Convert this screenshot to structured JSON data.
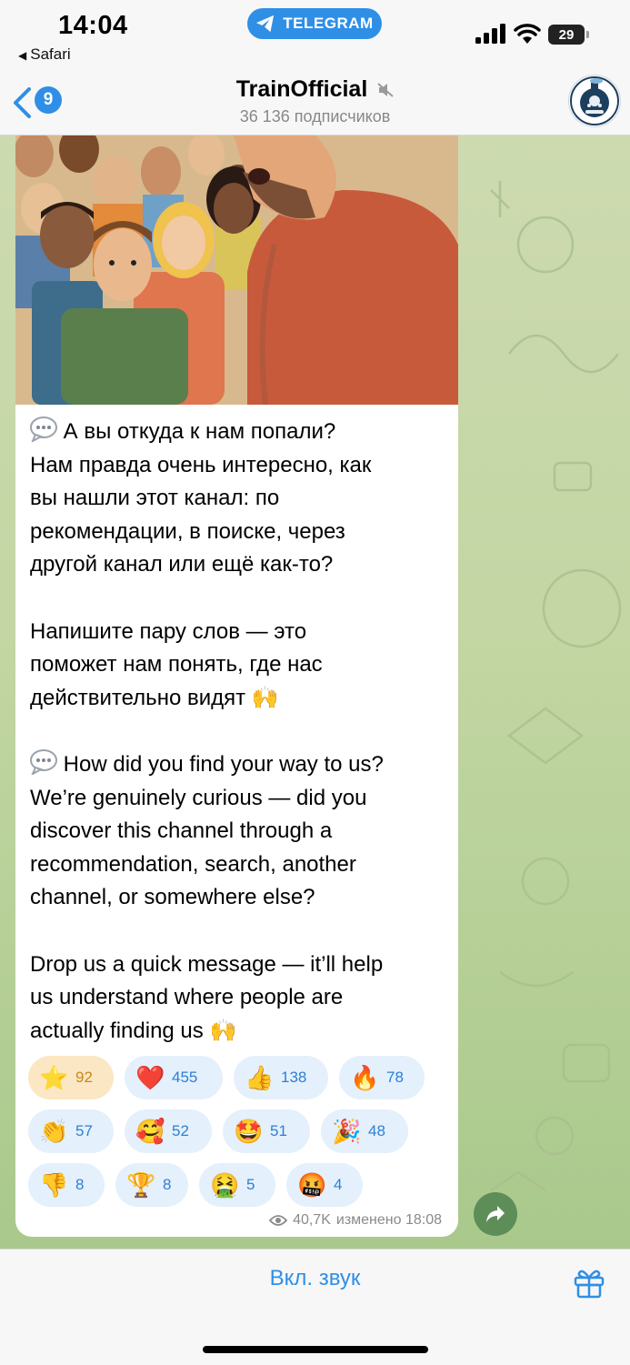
{
  "status_bar": {
    "time": "14:04",
    "back_app": "Safari",
    "app_pill": "TELEGRAM",
    "battery": "29"
  },
  "header": {
    "unread_count": "9",
    "channel_title": "TrainOfficial",
    "subscribers": "36 136 подписчиков",
    "icons": [
      "chevron-left-icon",
      "mute-icon",
      "channel-avatar"
    ]
  },
  "message": {
    "paragraphs": [
      "А вы откуда к нам попали?\nНам правда очень интересно, как\nвы нашли этот канал: по\nрекомендации, в поиске, через\nдругой канал или ещё как-то?",
      "Напишите пару слов — это\nпоможет нам понять, где нас\nдействительно видят",
      "How did you find your way to us?\nWe’re genuinely curious — did you\ndiscover this channel through a\nrecommendation, search, another\nchannel, or somewhere else?",
      "Drop us a quick message — it’ll help\nus understand where people are\nactually finding us"
    ],
    "reactions": [
      {
        "emoji": "⭐",
        "count": "92",
        "active": true
      },
      {
        "emoji": "❤️",
        "count": "455"
      },
      {
        "emoji": "👍",
        "count": "138"
      },
      {
        "emoji": "🔥",
        "count": "78"
      },
      {
        "emoji": "👏",
        "count": "57"
      },
      {
        "emoji": "🥰",
        "count": "52"
      },
      {
        "emoji": "🤩",
        "count": "51"
      },
      {
        "emoji": "🎉",
        "count": "48"
      },
      {
        "emoji": "👎",
        "count": "8"
      },
      {
        "emoji": "🏆",
        "count": "8"
      },
      {
        "emoji": "🤮",
        "count": "5"
      },
      {
        "emoji": "🤬",
        "count": "4"
      }
    ],
    "views": "40,7K",
    "edited_time": "изменено 18:08"
  },
  "bottom": {
    "unmute_label": "Вкл. звук"
  },
  "colors": {
    "accent": "#2f8fe6",
    "reaction_bg": "#e4f0fb",
    "reaction_active_bg": "#fbe7c3",
    "chat_bg": "#c3d6a3"
  }
}
